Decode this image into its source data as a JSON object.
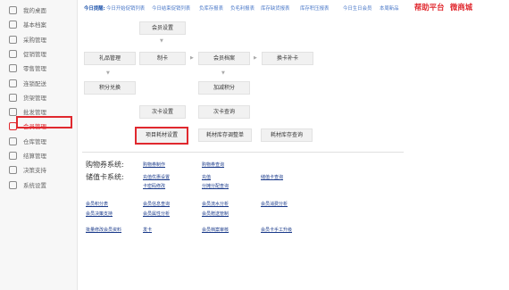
{
  "sidebar": {
    "items": [
      {
        "label": "我的桌面",
        "icon": "monitor-icon"
      },
      {
        "label": "基本档案",
        "icon": "folder-icon"
      },
      {
        "label": "采购管理",
        "icon": "cart-icon"
      },
      {
        "label": "促销管理",
        "icon": "tag-icon"
      },
      {
        "label": "零售管理",
        "icon": "store-icon"
      },
      {
        "label": "连锁配送",
        "icon": "truck-icon"
      },
      {
        "label": "货架管理",
        "icon": "shelf-icon"
      },
      {
        "label": "批发管理",
        "icon": "box-icon"
      },
      {
        "label": "会员管理",
        "icon": "member-icon"
      },
      {
        "label": "仓库管理",
        "icon": "warehouse-icon"
      },
      {
        "label": "结算管理",
        "icon": "calc-icon"
      },
      {
        "label": "决策支持",
        "icon": "chart-icon"
      },
      {
        "label": "系统设置",
        "icon": "gear-icon"
      }
    ],
    "active_index": 8
  },
  "topbar": {
    "label": "今日提醒:",
    "links": [
      "今日开始促销列表",
      "今日结束促销列表",
      "负库存报表",
      "负毛利报表",
      "库存缺货报表",
      "库存积压报表",
      "今日生日会员",
      "本周新品"
    ],
    "help": "帮助平台",
    "wechat": "微商城"
  },
  "flow": {
    "member_setting": "会员设置",
    "gift_manage": "礼品管理",
    "make_card": "制卡",
    "member_archive": "会员档案",
    "change_card": "换卡补卡",
    "points_exchange": "积分兑换",
    "add_points": "加减积分",
    "times_card_setting": "次卡设置",
    "times_card_query": "次卡查询",
    "item_material_setting": "项目耗材设置",
    "material_stock_adjust": "耗材库存调整单",
    "material_stock_query": "耗材库存查询"
  },
  "sections": {
    "coupon_title": "购物券系统:",
    "stored_title": "储值卡系统:",
    "coupon_make": "购物券制作",
    "coupon_query": "购物券查询",
    "recharge_rule": "充值优惠设置",
    "recharge": "充值",
    "stored_query": "储值卡查询",
    "card_pwd": "卡密码修改",
    "distribute_query": "分摊分配查询"
  },
  "reports": {
    "row1": [
      "会员积分表",
      "会员信息查询",
      "会员流水分析",
      "会员消费分析"
    ],
    "row2": [
      "会员决策支持",
      "会员属性分析",
      "会员赠送管制"
    ],
    "row3": [
      "批量修改会员资料",
      "发卡",
      "会员档案审核",
      "会员卡手工升级"
    ]
  }
}
